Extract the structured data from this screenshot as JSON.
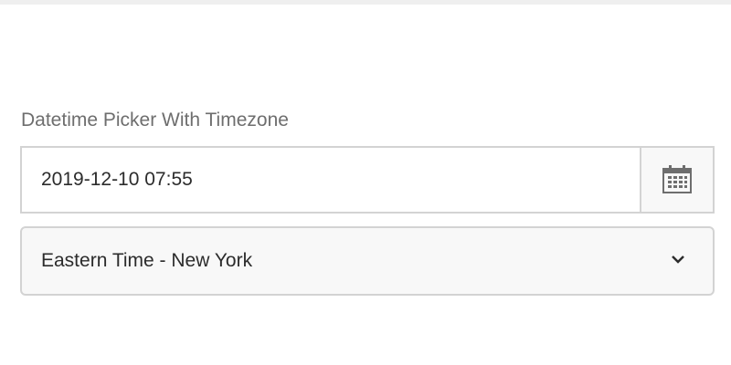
{
  "label": "Datetime Picker With Timezone",
  "datetime": {
    "value": "2019-12-10 07:55",
    "icon": "calendar-icon"
  },
  "timezone": {
    "selected": "Eastern Time - New York",
    "icon": "chevron-down-icon"
  }
}
